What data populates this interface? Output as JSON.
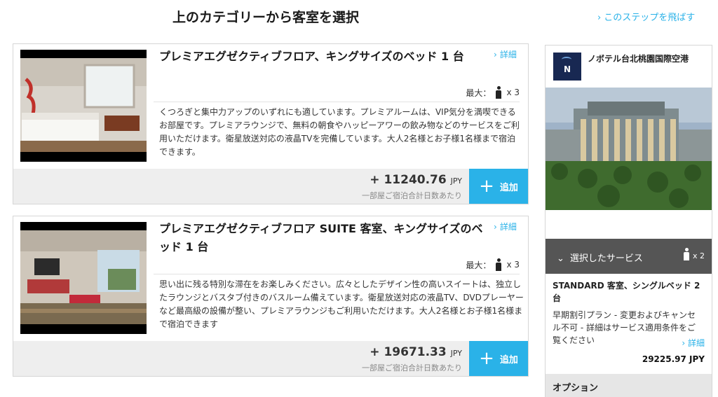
{
  "header": {
    "title": "上のカテゴリーから客室を選択",
    "skip_link": "このステップを飛ばす"
  },
  "rooms": [
    {
      "name": "プレミアエグゼクティブフロア、キングサイズのベッド 1 台",
      "detail_label": "詳細",
      "occupancy_label": "最大：",
      "occupancy_count": "x 3",
      "description": "くつろぎと集中力アップのいずれにも適しています。プレミアルームは、VIP気分を満喫できるお部屋です。プレミアラウンジで、無料の朝食やハッピーアワーの飲み物などのサービスをご利用いただけます。衛星放送対応の液晶TVを完備しています。大人2名様とお子様1名様まで宿泊できます。",
      "price": "+ 11240.76",
      "currency": "JPY",
      "price_note": "一部屋ご宿泊合計日数あたり",
      "add_label": "追加"
    },
    {
      "name": "プレミアエグゼクティブフロア SUITE 客室、キングサイズのベッド 1 台",
      "detail_label": "詳細",
      "occupancy_label": "最大：",
      "occupancy_count": "x 3",
      "description": "思い出に残る特別な滞在をお楽しみください。広々としたデザイン性の高いスイートは、独立したラウンジとバスタブ付きのバスルーム備えています。衛星放送対応の液晶TV、DVDプレーヤーなど最高級の設備が整い、プレミアラウンジもご利用いただけます。大人2名様とお子様1名様まで宿泊できます",
      "price": "+ 19671.33",
      "currency": "JPY",
      "price_note": "一部屋ご宿泊合計日数あたり",
      "add_label": "追加"
    }
  ],
  "sidebar": {
    "logo_letter": "N",
    "hotel_name": "ノボテル台北桃園国際空港",
    "services_label": "選択したサービス",
    "guest_count": "x 2",
    "selected_room": "STANDARD 客室、シングルベッド 2 台",
    "plan": "早期割引プラン - 変更およびキャンセル不可 - 詳細はサービス適用条件をご覧ください",
    "detail_label": "詳細",
    "total": "29225.97 JPY",
    "options_label": "オプション"
  },
  "colors": {
    "accent": "#2ab2e8",
    "price_bar": "#eeeeee",
    "services_bar": "#555555",
    "logo_bg": "#182852"
  }
}
